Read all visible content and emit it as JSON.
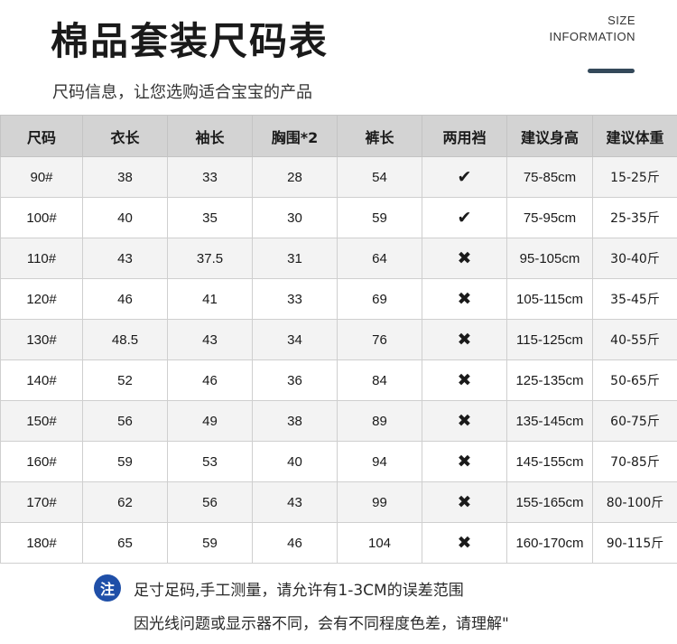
{
  "header": {
    "title": "棉品套装尺码表",
    "size_info_line1": "SIZE",
    "size_info_line2": "INFORMATION",
    "subtitle": "尺码信息，让您选购适合宝宝的产品"
  },
  "table": {
    "columns": [
      "尺码",
      "衣长",
      "袖长",
      "胸围*2",
      "裤长",
      "两用裆",
      "建议身高",
      "建议体重"
    ],
    "rows": [
      [
        "90#",
        "38",
        "33",
        "28",
        "54",
        "✔",
        "75-85cm",
        "15-25斤"
      ],
      [
        "100#",
        "40",
        "35",
        "30",
        "59",
        "✔",
        "75-95cm",
        "25-35斤"
      ],
      [
        "110#",
        "43",
        "37.5",
        "31",
        "64",
        "✖",
        "95-105cm",
        "30-40斤"
      ],
      [
        "120#",
        "46",
        "41",
        "33",
        "69",
        "✖",
        "105-115cm",
        "35-45斤"
      ],
      [
        "130#",
        "48.5",
        "43",
        "34",
        "76",
        "✖",
        "115-125cm",
        "40-55斤"
      ],
      [
        "140#",
        "52",
        "46",
        "36",
        "84",
        "✖",
        "125-135cm",
        "50-65斤"
      ],
      [
        "150#",
        "56",
        "49",
        "38",
        "89",
        "✖",
        "135-145cm",
        "60-75斤"
      ],
      [
        "160#",
        "59",
        "53",
        "40",
        "94",
        "✖",
        "145-155cm",
        "70-85斤"
      ],
      [
        "170#",
        "62",
        "56",
        "43",
        "99",
        "✖",
        "155-165cm",
        "80-100斤"
      ],
      [
        "180#",
        "65",
        "59",
        "46",
        "104",
        "✖",
        "160-170cm",
        "90-115斤"
      ]
    ]
  },
  "note": {
    "icon_label": "注",
    "line1": "足寸足码,手工测量，请允许有1-3CM的误差范围",
    "line2": "因光线问题或显示器不同，会有不同程度色差，请理解\""
  },
  "colors": {
    "header_bg": "#d3d3d3",
    "stripe": "#f3f3f3",
    "accent": "#34495a",
    "note_icon": "#1f4fa8"
  }
}
